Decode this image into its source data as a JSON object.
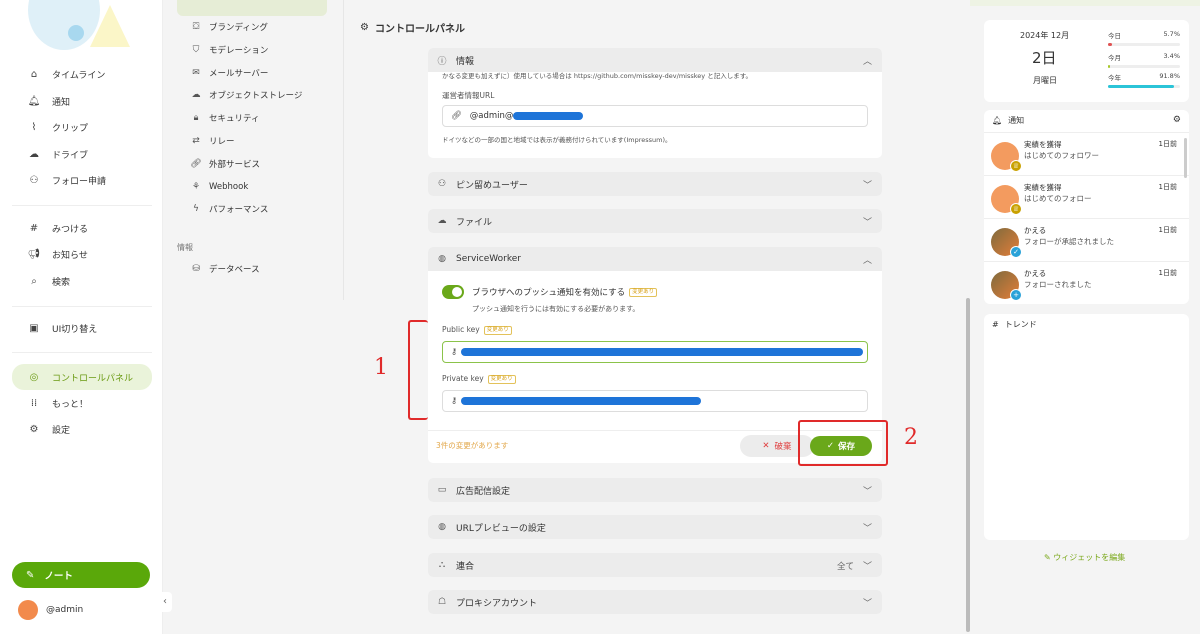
{
  "sidebar": {
    "items": [
      {
        "icon": "home-icon",
        "label": "タイムライン"
      },
      {
        "icon": "bell-icon",
        "label": "通知"
      },
      {
        "icon": "paperclip-icon",
        "label": "クリップ"
      },
      {
        "icon": "cloud-icon",
        "label": "ドライブ"
      },
      {
        "icon": "user-plus-icon",
        "label": "フォロー申請"
      },
      {
        "icon": "hash-icon",
        "label": "みつける"
      },
      {
        "icon": "megaphone-icon",
        "label": "お知らせ"
      },
      {
        "icon": "search-icon",
        "label": "検索"
      },
      {
        "icon": "devices-icon",
        "label": "UI切り替え"
      },
      {
        "icon": "gauge-icon",
        "label": "コントロールパネル"
      },
      {
        "icon": "grid-dots-icon",
        "label": "もっと！"
      },
      {
        "icon": "gear-icon",
        "label": "設定"
      }
    ],
    "note_button": "ノート",
    "user": "@admin"
  },
  "settings_menu": {
    "items": [
      {
        "icon": "paint-icon",
        "label": "ブランディング"
      },
      {
        "icon": "shield-icon",
        "label": "モデレーション"
      },
      {
        "icon": "mail-icon",
        "label": "メールサーバー"
      },
      {
        "icon": "cloud-icon",
        "label": "オブジェクトストレージ"
      },
      {
        "icon": "lock-icon",
        "label": "セキュリティ"
      },
      {
        "icon": "relay-icon",
        "label": "リレー"
      },
      {
        "icon": "link-icon",
        "label": "外部サービス"
      },
      {
        "icon": "webhook-icon",
        "label": "Webhook"
      },
      {
        "icon": "bolt-icon",
        "label": "パフォーマンス"
      }
    ],
    "section_info": "情報",
    "db_item": "データベース"
  },
  "main": {
    "title": "コントロールパネル",
    "info_panel": {
      "title": "情報",
      "note_cut": "かなる変更も加えずに）使用している場合は https://github.com/misskey-dev/misskey と記入します。",
      "operator_label": "運営者情報URL",
      "operator_value": "@admin@",
      "operator_caption": "ドイツなどの一部の国と地域では表示が義務付けられています(Impressum)。"
    },
    "pinned_users": "ピン留めユーザー",
    "files": "ファイル",
    "sw": {
      "title": "ServiceWorker",
      "toggle_label": "ブラウザへのプッシュ通知を有効にする",
      "changed_badge": "変更あり",
      "toggle_caption": "プッシュ通知を行うには有効にする必要があります。",
      "public_key_label": "Public key",
      "private_key_label": "Private key",
      "pending": "3件の変更があります",
      "discard": "破棄",
      "save": "保存"
    },
    "ads": "広告配信設定",
    "url_preview": "URLプレビューの設定",
    "federation": "連合",
    "federation_value": "全て",
    "proxy": "プロキシアカウント"
  },
  "calendar": {
    "year_month": "2024年 12月",
    "day": "2日",
    "weekday": "月曜日",
    "bars": [
      {
        "label": "今日",
        "pct": "5.7%",
        "value": 0.057,
        "color": "#e05252"
      },
      {
        "label": "今月",
        "pct": "3.4%",
        "value": 0.034,
        "color": "#a8c82a"
      },
      {
        "label": "今年",
        "pct": "91.8%",
        "value": 0.918,
        "color": "#2bc4d8"
      }
    ]
  },
  "notifications": {
    "title": "通知",
    "items": [
      {
        "t1": "実績を獲得",
        "t2": "はじめてのフォロワー",
        "time": "1日前",
        "sub": "trophy-icon",
        "sub_color": "#c9a100"
      },
      {
        "t1": "実績を獲得",
        "t2": "はじめてのフォロー",
        "time": "1日前",
        "sub": "trophy-icon",
        "sub_color": "#c9a100"
      },
      {
        "t1": "かえる",
        "t2": "フォローが承認されました",
        "time": "1日前",
        "sub": "check-icon",
        "sub_color": "#2aa2d8"
      },
      {
        "t1": "かえる",
        "t2": "フォローされました",
        "time": "1日前",
        "sub": "plus-icon",
        "sub_color": "#2aa2d8"
      }
    ]
  },
  "trends": {
    "title": "トレンド"
  },
  "edit_widgets": "ウィジェットを編集",
  "annotations": {
    "one": "1",
    "two": "2"
  }
}
